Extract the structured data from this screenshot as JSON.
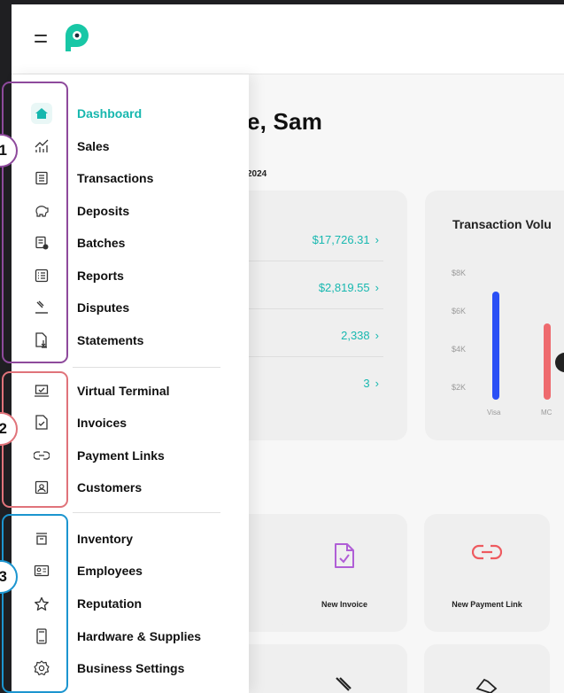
{
  "header": {
    "menu_icon": "hamburger-icon",
    "logo_icon": "p-logo-icon"
  },
  "colors": {
    "accent": "#17b7ae",
    "group1": "#8e4a9c",
    "group2": "#e0737a",
    "group3": "#1c95cf",
    "bar_visa": "#2a4ff5",
    "bar_mc": "#ee6a6e"
  },
  "dashboard": {
    "greeting": "e, Sam",
    "date": "2024",
    "summary_rows": [
      {
        "value": "$17,726.31",
        "chevron": "›"
      },
      {
        "value": "$2,819.55",
        "chevron": "›"
      },
      {
        "value": "2,338",
        "chevron": "›"
      },
      {
        "value": "3",
        "chevron": "›"
      }
    ],
    "chart_title": "Transaction Volu"
  },
  "chart_data": {
    "type": "bar",
    "title": "Transaction Volu",
    "categories": [
      "Visa",
      "MC"
    ],
    "values": [
      7.0,
      5.3
    ],
    "y_ticks": [
      "$8K",
      "$6K",
      "$4K",
      "$2K"
    ],
    "ylim": [
      2,
      8
    ],
    "colors": [
      "#2a4ff5",
      "#ee6a6e"
    ]
  },
  "quick_actions": [
    {
      "label": "New Invoice",
      "icon": "invoice-icon"
    },
    {
      "label": "New Payment Link",
      "icon": "link-icon"
    }
  ],
  "sidebar": {
    "groups": [
      {
        "badge": "1",
        "items": [
          {
            "label": "Dashboard",
            "icon": "home-icon",
            "active": true
          },
          {
            "label": "Sales",
            "icon": "sales-chart-icon"
          },
          {
            "label": "Transactions",
            "icon": "transactions-icon"
          },
          {
            "label": "Deposits",
            "icon": "piggy-bank-icon"
          },
          {
            "label": "Batches",
            "icon": "batches-icon"
          },
          {
            "label": "Reports",
            "icon": "reports-icon"
          },
          {
            "label": "Disputes",
            "icon": "gavel-icon"
          },
          {
            "label": "Statements",
            "icon": "statement-download-icon"
          }
        ]
      },
      {
        "badge": "2",
        "items": [
          {
            "label": "Virtual Terminal",
            "icon": "laptop-icon"
          },
          {
            "label": "Invoices",
            "icon": "invoice-icon"
          },
          {
            "label": "Payment Links",
            "icon": "link-icon"
          },
          {
            "label": "Customers",
            "icon": "customers-icon"
          }
        ]
      },
      {
        "badge": "3",
        "items": [
          {
            "label": "Inventory",
            "icon": "inventory-icon"
          },
          {
            "label": "Employees",
            "icon": "employee-id-icon"
          },
          {
            "label": "Reputation",
            "icon": "star-icon"
          },
          {
            "label": "Hardware & Supplies",
            "icon": "device-icon"
          },
          {
            "label": "Business Settings",
            "icon": "settings-gear-icon"
          }
        ]
      }
    ]
  }
}
